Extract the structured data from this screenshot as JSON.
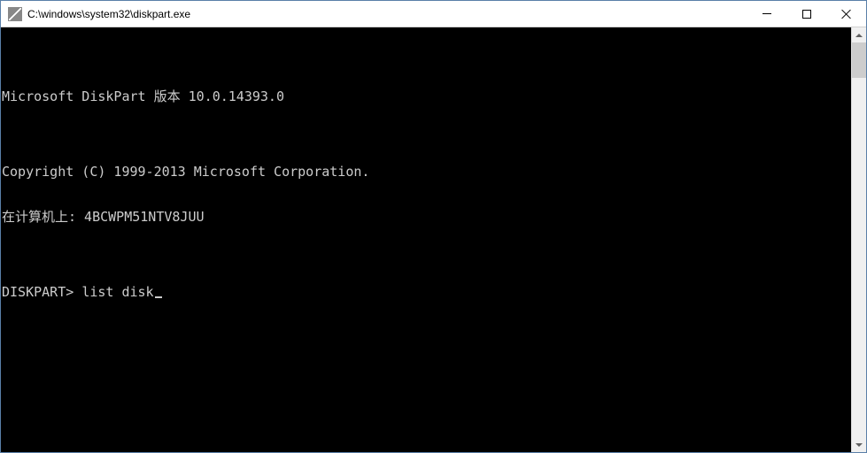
{
  "window": {
    "title": "C:\\windows\\system32\\diskpart.exe"
  },
  "terminal": {
    "lines": [
      "",
      "Microsoft DiskPart 版本 10.0.14393.0",
      "",
      "Copyright (C) 1999-2013 Microsoft Corporation.",
      "在计算机上: 4BCWPM51NTV8JUU",
      ""
    ],
    "prompt": "DISKPART> ",
    "command": "list disk"
  }
}
